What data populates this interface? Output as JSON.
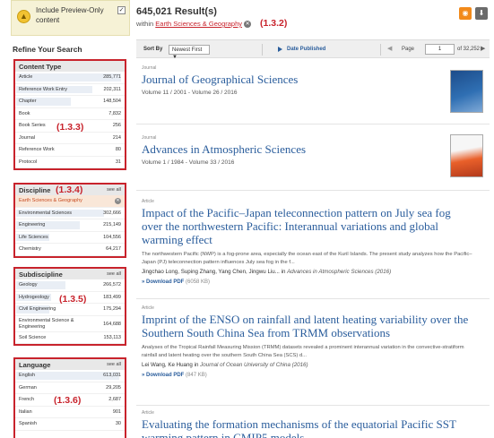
{
  "sidebar": {
    "preview_label": "Include Preview-Only content",
    "refine_title": "Refine Your Search",
    "see_all": "see all",
    "content_type": {
      "title": "Content Type",
      "items": [
        {
          "label": "Article",
          "count": "285,771"
        },
        {
          "label": "Reference Work Entry",
          "count": "202,311"
        },
        {
          "label": "Chapter",
          "count": "148,504"
        },
        {
          "label": "Book",
          "count": "7,832"
        },
        {
          "label": "Book Series",
          "count": "256"
        },
        {
          "label": "Journal",
          "count": "214"
        },
        {
          "label": "Reference Work",
          "count": "80"
        },
        {
          "label": "Protocol",
          "count": "31"
        }
      ]
    },
    "discipline": {
      "title": "Discipline",
      "selected": "Earth Sciences & Geography",
      "items": [
        {
          "label": "Environmental Sciences",
          "count": "302,666"
        },
        {
          "label": "Engineering",
          "count": "215,149"
        },
        {
          "label": "Life Sciences",
          "count": "104,556"
        },
        {
          "label": "Chemistry",
          "count": "64,217"
        }
      ]
    },
    "subdiscipline": {
      "title": "Subdiscipline",
      "items": [
        {
          "label": "Geology",
          "count": "266,572"
        },
        {
          "label": "Hydrogeology",
          "count": "183,499"
        },
        {
          "label": "Civil Engineering",
          "count": "175,294"
        },
        {
          "label": "Environmental Science & Engineering",
          "count": "164,688"
        },
        {
          "label": "Soil Science",
          "count": "153,113"
        }
      ]
    },
    "language": {
      "title": "Language",
      "items": [
        {
          "label": "English",
          "count": "613,031"
        },
        {
          "label": "German",
          "count": "29,205"
        },
        {
          "label": "French",
          "count": "2,687"
        },
        {
          "label": "Italian",
          "count": "901"
        },
        {
          "label": "Spanish",
          "count": "30"
        }
      ]
    }
  },
  "annotations": {
    "a132": "(1.3.2)",
    "a133": "(1.3.3)",
    "a134": "(1.3.4)",
    "a135": "(1.3.5)",
    "a136": "(1.3.6)"
  },
  "header": {
    "results_count": "645,021 Result(s)",
    "within_label": "within",
    "within_term": "Earth Sciences & Geography"
  },
  "toolbar": {
    "sort_by": "Sort By",
    "sort_value": "Newest First ▼",
    "date_published": "Date Published",
    "page_label": "Page",
    "page_value": "1",
    "page_of": "of 32,252"
  },
  "results": [
    {
      "type": "Journal",
      "title": "Journal of Geographical Sciences",
      "volume": "Volume 11 / 2001 - Volume 26 / 2016"
    },
    {
      "type": "Journal",
      "title": "Advances in Atmospheric Sciences",
      "volume": "Volume 1 / 1984 - Volume 33 / 2016"
    },
    {
      "type": "Article",
      "title": "Impact of the Pacific–Japan teleconnection pattern on July sea fog over the northwestern Pacific: Interannual variations and global warming effect",
      "abstract": "The northwestern Pacific (NWP) is a fog-prone area, especially the ocean east of the Kuril Islands. The present study analyzes how the Pacific–Japan (PJ) teleconnection pattern influences July sea fog in the f...",
      "authors": "Jingchao Long, Suping Zhang, Yang Chen, Jingwu Liu... in",
      "journal": "Advances in Atmospheric Sciences (2016)",
      "pdf": "» Download PDF",
      "size": "(6058 KB)"
    },
    {
      "type": "Article",
      "title": "Imprint of the ENSO on rainfall and latent heating variability over the Southern South China Sea from TRMM observations",
      "abstract": "Analyses of the Tropical Rainfall Measuring Mission (TRMM) datasets revealed a prominent interannual variation in the convective-stratiform rainfall and latent heating over the southern South China Sea (SCS) d...",
      "authors": "Lei Wang, Ke Huang in",
      "journal": "Journal of Ocean University of China (2016)",
      "pdf": "» Download PDF",
      "size": "(847 KB)"
    },
    {
      "type": "Article",
      "title": "Evaluating the formation mechanisms of the equatorial Pacific SST warming pattern in CMIP5 models"
    }
  ],
  "colors": {
    "accent_red": "#c8232c",
    "link_blue": "#2a5d9c",
    "rss_orange": "#f28a1b"
  }
}
